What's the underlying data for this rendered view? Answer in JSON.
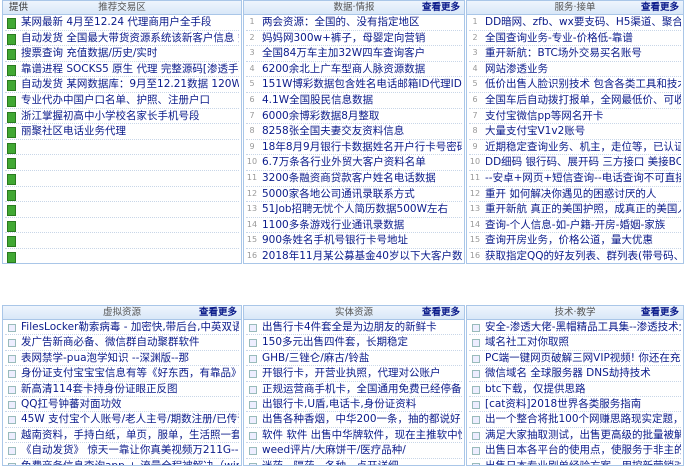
{
  "panels": [
    {
      "head_left": "提供",
      "title": "推荐交易区",
      "more": "",
      "rows": [
        "某网最新 4月至12.24 代理商用户全手段",
        "自动发货 全国最大带货资源系统该新客户信息 氪",
        "搜票查询 充值数据/历史/实时",
        "靠谱进程 SOCKS5 原生 代理 完整源码[渗透手段",
        "自动发货 某网数据库：9月至12.21数据 120W+",
        "专业代办中国户口名单、护照、注册户口",
        "浙江掌握初高中小学校名家长手机号段",
        "丽聚社区电话业务代理",
        "",
        "",
        "",
        "",
        "",
        "",
        "",
        "",
        ""
      ]
    },
    {
      "head_left": "",
      "title": "数据·情报",
      "more": "查看更多",
      "rows": [
        "两会资源：全国的、没有指定地区",
        "妈妈网300w+裤子，母婴定向营销",
        "全国84万车主加32W四车查询客户",
        "6200余北上广车型商人脉资源数据",
        "151W博彩数据包含姓名电话邮箱ID代理ID",
        "4.1W全国股民信息数据",
        "6000余博彩数据8月整取",
        "8258张全国夫妻交友资料信息",
        "18年8月9月银行卡数据姓名开户行卡号密码证件号",
        "6.7万条各行业外贸大客户资料名单",
        "3200条融资商贷款客户姓名电话数据",
        "5000家各地公司通讯录联系方式",
        "51Job招聘无忧个人简历数据500W左右",
        "1100多条游戏行业通讯录数据",
        "900条姓名手机号银行卡号地址",
        "2018年11月某公募基金40岁以下大客户数据2000",
        "宝妈网-51job-深圳业主-全国车主、贵游自属，自"
      ]
    },
    {
      "head_left": "",
      "title": "服务·接单",
      "more": "查看更多",
      "rows": [
        "DD暗网、zfb、wx要支码、H5渠道、聚合高家码",
        "全国查询业务-专业-价格低-靠谱",
        "重开新航：BTC场外交易买名账号",
        "网站渗透业务",
        "低价出售人脸识别技术 包含各类工具和技术教程",
        "全国车后自动拨打报单，全网最低价、可收代理。",
        "支付宝微信pp等网名开卡",
        "大量支付宝V1v2账号",
        "近期稳定查询业务、机主，走位等，已认证",
        "DD细码 银行码、展开码 三方接口 美接BC CP SS",
        "--安卓+网页+短信查询--电话查询不可直接呼叫到",
        "重开 如何解决你遇见的困惑讨厌的人",
        "重开新航 真正的美国护照，成真正的美国人！",
        "查询-个人信息-如-户籍-开房-婚姻-家族",
        "查询开房业务，价格公道，量大优惠",
        "获取指定QQ的好友列表、群列表(带号码、备注)",
        "支付宝内部解封账号，全网最低价"
      ]
    },
    {
      "head_left": "",
      "title": "虚拟资源",
      "more": "查看更多",
      "rows": [
        "FilesLocker勒索病毒 - 加密快,带后台,中英双语勒",
        "发广告新商必备、微信群自动聚群软件",
        "表网禁学-pua泡学知识 --深渊版--那",
        "身份证支付宝宝宝信息有等《好东西，有靠品》",
        "新高清114套卡持身份证眼正反图",
        "QQ扛号钟蕃对面功效",
        "45W 支付宝个人账号/老人主号/期数注册/已传证",
        "越南资料，手持白纸，单页，服单，生活照一套",
        "《自动发货》 惊天一靠让你真美视频万211G--",
        "免费商务信息查询app + 流量全程被解决（win)",
        ""
      ]
    },
    {
      "head_left": "",
      "title": "实体资源",
      "more": "查看更多",
      "rows": [
        "出售行卡4件套全是为边朋友的新鲜卡",
        "150多元出售四件套，长期稳定",
        "GHB/三锉仑/麻古/铃盐",
        "开银行卡，开营业执照，代理对公账户",
        "正规运营商手机卡，全国通用免费已经停备 插卡直",
        "出银行卡,U盾,电话卡,身份证资料",
        "出售各种香烟，中华200一条，抽的都说好",
        "软件 软件 出售中华牌软件，现在主推软中性",
        "weed评片/大麻饼干/医疗品种/",
        "迷药、隔药、各种，点开详细",
        ""
      ]
    },
    {
      "head_left": "",
      "title": "技术·教学",
      "more": "查看更多",
      "rows": [
        "安全-渗透大佬-黑帽精品工具集--渗透技术大佬的",
        "域名社工对你取照",
        "PC端一键网页破解三网VIP视频! 你还在充会员?",
        "微信域名 全球服务器 DNS劫持技术",
        "btc下载，仅提供思路",
        "[cat资料]2018世界各类服务指南",
        "出一个整合将批100个网赚思路现实定题，爆炸的1",
        "满足大家抽取测试，出售更高级的批量被解开服务",
        "出售日本各平台的使用点，使服务于非主的事情",
        "出售日本专业刷单经验方案，用控新营销对应销售",
        ""
      ]
    }
  ]
}
